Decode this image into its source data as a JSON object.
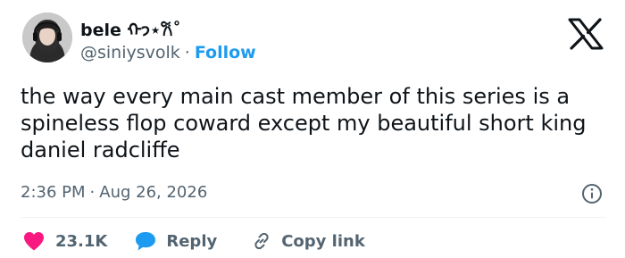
{
  "author": {
    "display_name": "bele ᡣ𐭩⋆𐙚˚",
    "handle": "@siniysvolk",
    "separator": "·",
    "follow_label": "Follow"
  },
  "tweet": {
    "text": "the way every main cast member of this series is a spineless flop coward except my beautiful short king daniel radcliffe",
    "time": "2:36 PM",
    "separator": "·",
    "date": "Aug 26, 2026"
  },
  "actions": {
    "like_count": "23.1K",
    "reply_label": "Reply",
    "copy_label": "Copy link"
  },
  "icons": {
    "logo": "x-logo-icon",
    "info": "info-icon",
    "like": "heart-icon",
    "reply": "speech-bubble-icon",
    "copy": "link-icon"
  },
  "colors": {
    "text": "#0f1419",
    "secondary": "#536471",
    "accent": "#1d9bf0",
    "like": "#f91880",
    "divider": "#eff3f4"
  }
}
